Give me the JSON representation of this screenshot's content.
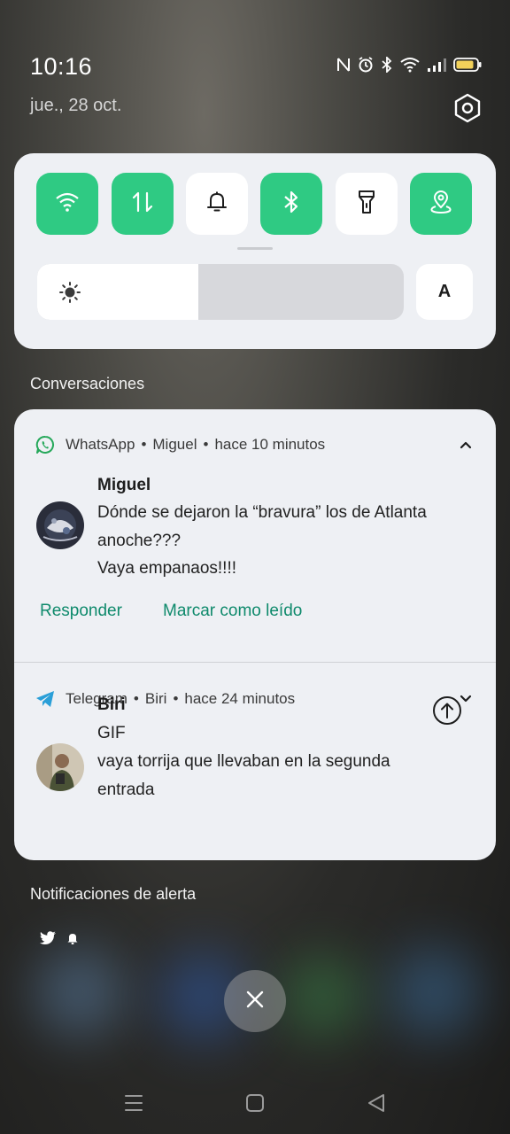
{
  "status_bar": {
    "time": "10:16",
    "date": "jue., 28 oct.",
    "icons": [
      "nfc-icon",
      "alarm-icon",
      "bluetooth-icon",
      "wifi-icon",
      "signal-icon",
      "battery-icon"
    ]
  },
  "quick_settings": {
    "tiles": [
      {
        "name": "wifi",
        "icon": "wifi-icon",
        "on": true
      },
      {
        "name": "mobile-data",
        "icon": "data-arrows-icon",
        "on": true
      },
      {
        "name": "sound",
        "icon": "bell-icon",
        "on": false
      },
      {
        "name": "bluetooth",
        "icon": "bluetooth-icon",
        "on": true
      },
      {
        "name": "flashlight",
        "icon": "flashlight-icon",
        "on": false
      },
      {
        "name": "location",
        "icon": "location-icon",
        "on": true
      }
    ],
    "brightness_level": 0.44,
    "auto_label": "A",
    "accent_color": "#2fca83"
  },
  "sections": {
    "conversations": "Conversaciones",
    "alerts": "Notificaciones de alerta"
  },
  "notifications": [
    {
      "app": "WhatsApp",
      "contact": "Miguel",
      "time": "hace 10 minutos",
      "sender": "Miguel",
      "lines": [
        "Dónde se dejaron la “bravura” los de Atlanta",
        "anoche???",
        "Vaya empanaos!!!!"
      ],
      "actions": [
        "Responder",
        "Marcar como leído"
      ],
      "expanded": true
    },
    {
      "app": "Telegram",
      "contact": "Biri",
      "time": "hace 24 minutos",
      "sender": "Biri",
      "lines": [
        "GIF",
        "vaya torrija que llevaban en la segunda",
        "entrada"
      ],
      "expanded": false
    }
  ],
  "colors": {
    "action_text": "#0f8a6c",
    "whatsapp": "#25a85a",
    "telegram": "#2a9fd8"
  }
}
